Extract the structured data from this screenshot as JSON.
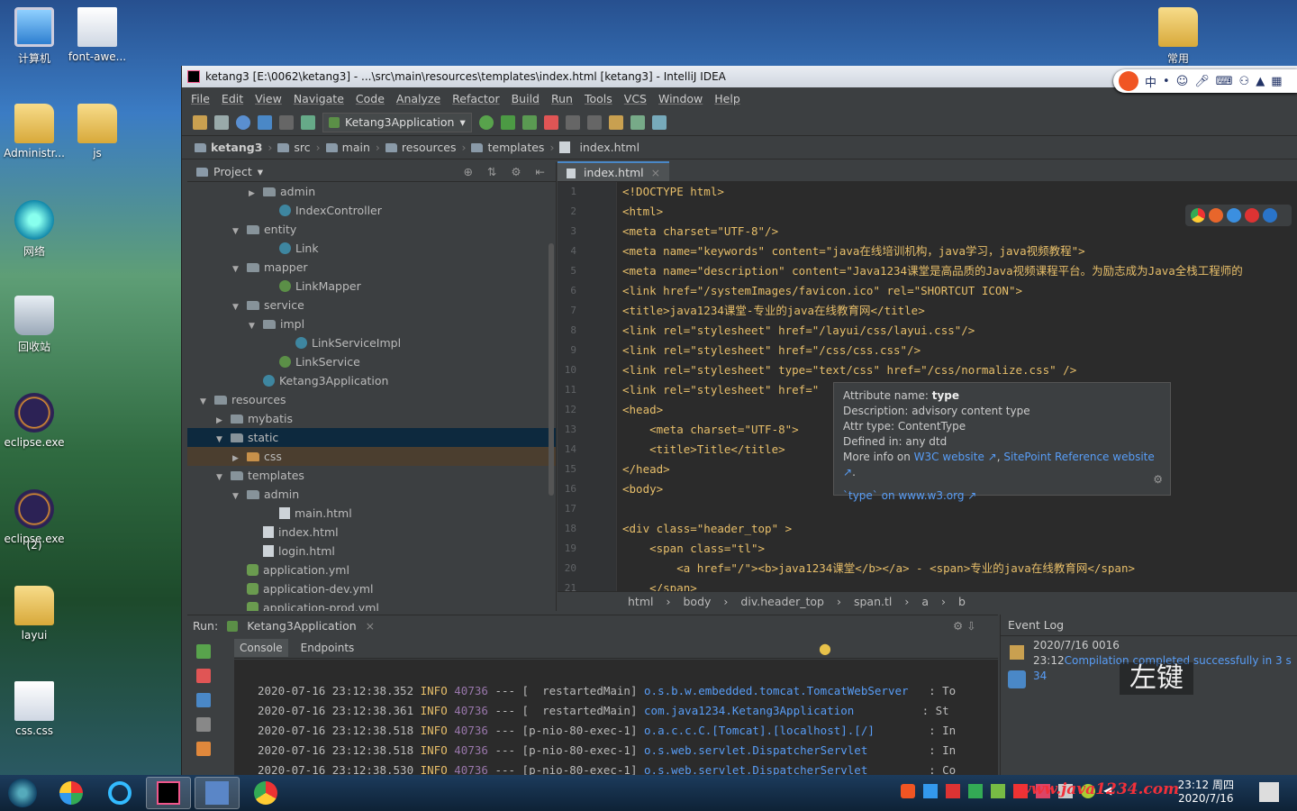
{
  "desktop": {
    "icons": [
      {
        "label": "计算机",
        "kind": "pc"
      },
      {
        "label": "font-awe...",
        "kind": "doc"
      },
      {
        "label": "Administr...",
        "kind": "folder"
      },
      {
        "label": "js",
        "kind": "folder"
      },
      {
        "label": "网络",
        "kind": "net"
      },
      {
        "label": "回收站",
        "kind": "bin"
      },
      {
        "label": "eclipse.exe",
        "kind": "ecl"
      },
      {
        "label": "eclipse.exe",
        "kind": "ecl"
      },
      {
        "label": "(2)",
        "kind": "none"
      },
      {
        "label": "layui",
        "kind": "folder"
      },
      {
        "label": "css.css",
        "kind": "doc"
      },
      {
        "label": "常用",
        "kind": "folder"
      }
    ]
  },
  "window": {
    "title": "ketang3 [E:\\0062\\ketang3] - ...\\src\\main\\resources\\templates\\index.html [ketang3] - IntelliJ IDEA"
  },
  "menu": [
    "File",
    "Edit",
    "View",
    "Navigate",
    "Code",
    "Analyze",
    "Refactor",
    "Build",
    "Run",
    "Tools",
    "VCS",
    "Window",
    "Help"
  ],
  "toolbar": {
    "run_config": "Ketang3Application"
  },
  "breadcrumb": [
    "ketang3",
    "src",
    "main",
    "resources",
    "templates",
    "index.html"
  ],
  "project": {
    "label": "Project",
    "rows": [
      {
        "t": "admin",
        "d": 6,
        "k": "folder",
        "tw": "▶"
      },
      {
        "t": "IndexController",
        "d": 7,
        "k": "class",
        "tw": ""
      },
      {
        "t": "entity",
        "d": 5,
        "k": "folder",
        "tw": "▼"
      },
      {
        "t": "Link",
        "d": 7,
        "k": "class",
        "tw": ""
      },
      {
        "t": "mapper",
        "d": 5,
        "k": "folder",
        "tw": "▼"
      },
      {
        "t": "LinkMapper",
        "d": 7,
        "k": "iface",
        "tw": ""
      },
      {
        "t": "service",
        "d": 5,
        "k": "folder",
        "tw": "▼"
      },
      {
        "t": "impl",
        "d": 6,
        "k": "folder",
        "tw": "▼"
      },
      {
        "t": "LinkServiceImpl",
        "d": 8,
        "k": "class",
        "tw": ""
      },
      {
        "t": "LinkService",
        "d": 7,
        "k": "iface",
        "tw": ""
      },
      {
        "t": "Ketang3Application",
        "d": 6,
        "k": "class",
        "tw": ""
      },
      {
        "t": "resources",
        "d": 3,
        "k": "folder",
        "tw": "▼"
      },
      {
        "t": "mybatis",
        "d": 4,
        "k": "folder",
        "tw": "▶"
      },
      {
        "t": "static",
        "d": 4,
        "k": "folder",
        "tw": "▼",
        "sel": "sel"
      },
      {
        "t": "css",
        "d": 5,
        "k": "ofolder",
        "tw": "▶",
        "sel": "sel2"
      },
      {
        "t": "templates",
        "d": 4,
        "k": "folder",
        "tw": "▼"
      },
      {
        "t": "admin",
        "d": 5,
        "k": "folder",
        "tw": "▼"
      },
      {
        "t": "main.html",
        "d": 7,
        "k": "html",
        "tw": ""
      },
      {
        "t": "index.html",
        "d": 6,
        "k": "html",
        "tw": ""
      },
      {
        "t": "login.html",
        "d": 6,
        "k": "html",
        "tw": ""
      },
      {
        "t": "application.yml",
        "d": 5,
        "k": "yml",
        "tw": ""
      },
      {
        "t": "application-dev.yml",
        "d": 5,
        "k": "yml",
        "tw": ""
      },
      {
        "t": "application-prod.yml",
        "d": 5,
        "k": "yml",
        "tw": ""
      }
    ]
  },
  "editor": {
    "tab": "index.html",
    "lines": [
      "<!DOCTYPE html>",
      "<html>",
      "<meta charset=\"UTF-8\"/>",
      "<meta name=\"keywords\" content=\"java在线培训机构，java学习，java视频教程\">",
      "<meta name=\"description\" content=\"Java1234课堂是高品质的Java视频课程平台。为励志成为Java全栈工程师的",
      "<link href=\"/systemImages/favicon.ico\" rel=\"SHORTCUT ICON\">",
      "<title>java1234课堂-专业的java在线教育网</title>",
      "<link rel=\"stylesheet\" href=\"/layui/css/layui.css\"/>",
      "<link rel=\"stylesheet\" href=\"/css/css.css\"/>",
      "<link rel=\"stylesheet\" type=\"text/css\" href=\"/css/normalize.css\" />",
      "<link rel=\"stylesheet\" href=\"",
      "<head>",
      "    <meta charset=\"UTF-8\">",
      "    <title>Title</title>",
      "</head>",
      "<body>",
      "",
      "<div class=\"header_top\" >",
      "    <span class=\"tl\">",
      "        <a href=\"/\"><b>java1234课堂</b></a> - <span>专业的java在线教育网</span>",
      "    </span>"
    ],
    "crumbs": [
      "html",
      "body",
      "div.header_top",
      "span.tl",
      "a",
      "b"
    ]
  },
  "tooltip": {
    "l1a": "Attribute name: ",
    "l1b": "type",
    "l2": "Description: advisory content type",
    "l3": "Attr type: ContentType",
    "l4": "Defined in: any dtd",
    "l5a": "More info on ",
    "link1": "W3C website ↗",
    "sep": ", ",
    "link2": "SitePoint Reference website ↗",
    "dot": ".",
    "l6": "`type` on www.w3.org ↗"
  },
  "run": {
    "label": "Run:",
    "app": "Ketang3Application",
    "tabs": [
      "Console",
      "Endpoints"
    ],
    "log": [
      {
        "ts": "2020-07-16 23:12:38.352",
        "lvl": "INFO",
        "pid": "40736",
        "sep": "---",
        "th": "[  restartedMain]",
        "cls": "o.s.b.w.embedded.tomcat.TomcatWebServer",
        "msg": "  : To"
      },
      {
        "ts": "2020-07-16 23:12:38.361",
        "lvl": "INFO",
        "pid": "40736",
        "sep": "---",
        "th": "[  restartedMain]",
        "cls": "com.java1234.Ketang3Application       ",
        "msg": "  : St"
      },
      {
        "ts": "2020-07-16 23:12:38.518",
        "lvl": "INFO",
        "pid": "40736",
        "sep": "---",
        "th": "[p-nio-80-exec-1]",
        "cls": "o.a.c.c.C.[Tomcat].[localhost].[/]     ",
        "msg": "  : In"
      },
      {
        "ts": "2020-07-16 23:12:38.518",
        "lvl": "INFO",
        "pid": "40736",
        "sep": "---",
        "th": "[p-nio-80-exec-1]",
        "cls": "o.s.web.servlet.DispatcherServlet      ",
        "msg": "  : In"
      },
      {
        "ts": "2020-07-16 23:12:38.530",
        "lvl": "INFO",
        "pid": "40736",
        "sep": "---",
        "th": "[p-nio-80-exec-1]",
        "cls": "o.s.web.servlet.DispatcherServlet      ",
        "msg": "  : Co"
      }
    ]
  },
  "eventlog": {
    "title": "Event Log",
    "date": "2020/7/16 0016",
    "time": "23:12",
    "msg": "Compilation completed successfully in 3 s 34"
  },
  "overlay": "左键",
  "ime": {
    "lang": "中"
  },
  "taskbar": {
    "time": "23:12 周四",
    "date": "2020/7/16"
  },
  "watermark": "www.java1234.com"
}
